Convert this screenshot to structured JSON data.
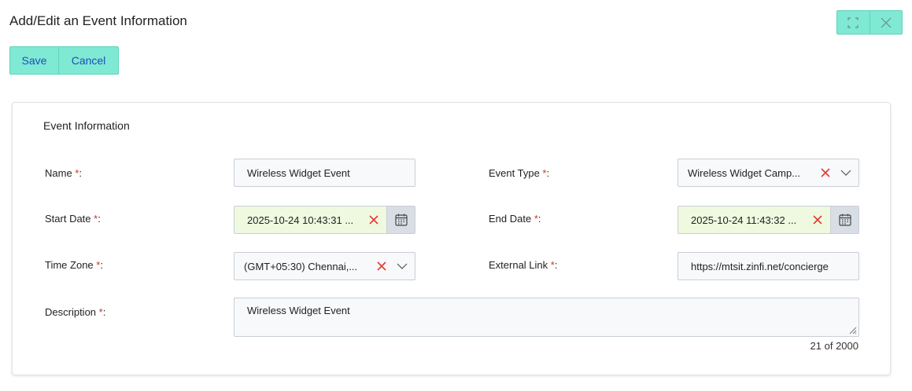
{
  "header": {
    "title": "Add/Edit an Event Information"
  },
  "window_controls": {
    "expand_icon": "expand-icon",
    "close_icon": "close-icon"
  },
  "toolbar": {
    "save_label": "Save",
    "cancel_label": "Cancel"
  },
  "section": {
    "title": "Event Information"
  },
  "required_marker": "*",
  "fields": {
    "name": {
      "label": "Name ",
      "suffix": ":",
      "value": "Wireless Widget Event"
    },
    "event_type": {
      "label": "Event Type ",
      "suffix": ":",
      "value": "Wireless Widget Camp..."
    },
    "start_date": {
      "label": "Start Date ",
      "suffix": ":",
      "value": "2025-10-24 10:43:31 ..."
    },
    "end_date": {
      "label": "End Date ",
      "suffix": ":",
      "value": "2025-10-24 11:43:32 ..."
    },
    "time_zone": {
      "label": "Time Zone ",
      "suffix": ":",
      "value": "(GMT+05:30) Chennai,..."
    },
    "external_link": {
      "label": "External Link ",
      "suffix": ":",
      "value": "https://mtsit.zinfi.net/concierge"
    },
    "description": {
      "label": "Description ",
      "suffix": ":",
      "value": "Wireless Widget Event",
      "counter": "21 of 2000"
    }
  },
  "colors": {
    "accent": "#7fe9d4",
    "link_text": "#1b4fb5",
    "required": "#c0392b",
    "clear_x": "#e53935",
    "date_bg": "#eef9df"
  }
}
